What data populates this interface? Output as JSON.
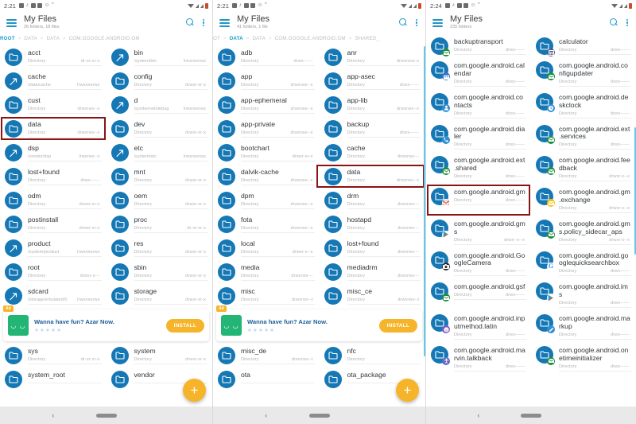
{
  "app": {
    "title": "My Files",
    "icons": {
      "menu": "hamburger-icon",
      "search": "search-icon",
      "overflow": "kebab-menu-icon",
      "fab": "add-fab-icon",
      "back": "back-nav-icon",
      "home": "home-pill-icon"
    }
  },
  "ad": {
    "tag": "Ad",
    "title": "Wanna have fun? Azar Now.",
    "stars": "★★★★★",
    "button": "INSTALL"
  },
  "colors": {
    "accent": "#1a9ad0",
    "folder": "#1578b5",
    "highlight": "#8a1313",
    "fab": "#f6b42a",
    "scrollbar": "#64c8e8"
  },
  "panels": [
    {
      "status": {
        "time": "2:21",
        "battery": "low"
      },
      "subtitle": "26 folders, 18 files",
      "breadcrumbs": [
        {
          "label": "ROOT",
          "active": true
        },
        {
          "label": "DATA",
          "active": false
        },
        {
          "label": "DATA",
          "active": false
        },
        {
          "label": "COM.GOOGLE.ANDROID.GM",
          "active": false
        }
      ],
      "items": [
        {
          "name": "acct",
          "type": "Directory",
          "perm": "dr-xr-xr-x",
          "kind": "folder"
        },
        {
          "name": "bin",
          "type": "/system/bin",
          "perm": "lrwxrwxrwx",
          "kind": "link"
        },
        {
          "name": "cache",
          "type": "/data/cache",
          "perm": "lrwxrwxrwx",
          "kind": "link"
        },
        {
          "name": "config",
          "type": "Directory",
          "perm": "drwxr-xr-x",
          "kind": "folder"
        },
        {
          "name": "cust",
          "type": "Directory",
          "perm": "drwxrwx--x",
          "kind": "folder"
        },
        {
          "name": "d",
          "type": "/sys/kernel/debug",
          "perm": "lrwxrwxrwx",
          "kind": "link"
        },
        {
          "name": "data",
          "type": "Directory",
          "perm": "drwxrwx--x",
          "kind": "folder",
          "highlight": true
        },
        {
          "name": "dev",
          "type": "Directory",
          "perm": "drwxr-xr-x",
          "kind": "folder"
        },
        {
          "name": "dsp",
          "type": "/vendor/dsp",
          "perm": "lrwxrwx--x",
          "kind": "link"
        },
        {
          "name": "etc",
          "type": "/system/etc",
          "perm": "lrwxrwxrwx",
          "kind": "link"
        },
        {
          "name": "lost+found",
          "type": "Directory",
          "perm": "drwx------",
          "kind": "folder"
        },
        {
          "name": "mnt",
          "type": "Directory",
          "perm": "drwxr-xr-x",
          "kind": "folder"
        },
        {
          "name": "odm",
          "type": "Directory",
          "perm": "drwxr-xr-x",
          "kind": "folder"
        },
        {
          "name": "oem",
          "type": "Directory",
          "perm": "drwxr-xr-x",
          "kind": "folder"
        },
        {
          "name": "postinstall",
          "type": "Directory",
          "perm": "drwxr-xr-x",
          "kind": "folder"
        },
        {
          "name": "proc",
          "type": "Directory",
          "perm": "dr-xr-xr-x",
          "kind": "folder"
        },
        {
          "name": "product",
          "type": "/system/product",
          "perm": "lrwxrwxrwx",
          "kind": "link"
        },
        {
          "name": "res",
          "type": "Directory",
          "perm": "drwxr-xr-x",
          "kind": "folder"
        },
        {
          "name": "root",
          "type": "Directory",
          "perm": "drwxr-x---",
          "kind": "folder"
        },
        {
          "name": "sbin",
          "type": "Directory",
          "perm": "drwxr-xr-x",
          "kind": "folder"
        },
        {
          "name": "sdcard",
          "type": "/storage/emulated/0",
          "perm": "lrwxrwxrwx",
          "kind": "link"
        },
        {
          "name": "storage",
          "type": "Directory",
          "perm": "drwxr-xr-x",
          "kind": "folder"
        }
      ],
      "items_after_ad": [
        {
          "name": "sys",
          "type": "Directory",
          "perm": "dr-xr-xr-x",
          "kind": "folder"
        },
        {
          "name": "system",
          "type": "Directory",
          "perm": "drwxr-xr-x",
          "kind": "folder"
        },
        {
          "name": "system_root",
          "type": "",
          "perm": "",
          "kind": "folder"
        },
        {
          "name": "vendor",
          "type": "",
          "perm": "",
          "kind": "folder"
        }
      ]
    },
    {
      "status": {
        "time": "2:21",
        "battery": "low"
      },
      "subtitle": "41 folders, 1 file",
      "breadcrumbs": [
        {
          "label": "OT",
          "active": false
        },
        {
          "label": "DATA",
          "active": true
        },
        {
          "label": "DATA",
          "active": false
        },
        {
          "label": "COM.GOOGLE.ANDROID.GM",
          "active": false
        },
        {
          "label": "SHARED_",
          "active": false
        }
      ],
      "items": [
        {
          "name": "adb",
          "type": "Directory",
          "perm": "drwx------",
          "kind": "folder"
        },
        {
          "name": "anr",
          "type": "Directory",
          "perm": "drwxrwxr-x",
          "kind": "folder"
        },
        {
          "name": "app",
          "type": "Directory",
          "perm": "drwxrwx--x",
          "kind": "folder"
        },
        {
          "name": "app-asec",
          "type": "Directory",
          "perm": "drwx------",
          "kind": "folder"
        },
        {
          "name": "app-ephemeral",
          "type": "Directory",
          "perm": "drwxrwx--x",
          "kind": "folder"
        },
        {
          "name": "app-lib",
          "type": "Directory",
          "perm": "drwxrwx--x",
          "kind": "folder"
        },
        {
          "name": "app-private",
          "type": "Directory",
          "perm": "drwxrwx--x",
          "kind": "folder"
        },
        {
          "name": "backup",
          "type": "Directory",
          "perm": "drwx------",
          "kind": "folder"
        },
        {
          "name": "bootchart",
          "type": "Directory",
          "perm": "drwxr-xr-x",
          "kind": "folder"
        },
        {
          "name": "cache",
          "type": "Directory",
          "perm": "drwxrwx---",
          "kind": "folder"
        },
        {
          "name": "dalvik-cache",
          "type": "Directory",
          "perm": "drwxrwx--x",
          "kind": "folder"
        },
        {
          "name": "data",
          "type": "Directory",
          "perm": "drwxrwx--x",
          "kind": "folder",
          "highlight": true
        },
        {
          "name": "dpm",
          "type": "Directory",
          "perm": "drwxrwx--x",
          "kind": "folder"
        },
        {
          "name": "drm",
          "type": "Directory",
          "perm": "drwxrwx---",
          "kind": "folder"
        },
        {
          "name": "fota",
          "type": "Directory",
          "perm": "drwxrwx--x",
          "kind": "folder"
        },
        {
          "name": "hostapd",
          "type": "Directory",
          "perm": "drwxrwx---",
          "kind": "folder"
        },
        {
          "name": "local",
          "type": "Directory",
          "perm": "drwxr-x--x",
          "kind": "folder"
        },
        {
          "name": "lost+found",
          "type": "Directory",
          "perm": "drwxrwx---",
          "kind": "folder"
        },
        {
          "name": "media",
          "type": "Directory",
          "perm": "drwxrwx---",
          "kind": "folder"
        },
        {
          "name": "mediadrm",
          "type": "Directory",
          "perm": "drwxrwx---",
          "kind": "folder"
        },
        {
          "name": "misc",
          "type": "Directory",
          "perm": "drwxrwx--t",
          "kind": "folder"
        },
        {
          "name": "misc_ce",
          "type": "Directory",
          "perm": "drwxrwx--t",
          "kind": "folder"
        }
      ],
      "items_after_ad": [
        {
          "name": "misc_de",
          "type": "Directory",
          "perm": "drwxrwx--t",
          "kind": "folder"
        },
        {
          "name": "nfc",
          "type": "Directory",
          "perm": "",
          "kind": "folder"
        },
        {
          "name": "ota",
          "type": "",
          "perm": "",
          "kind": "folder"
        },
        {
          "name": "ota_package",
          "type": "",
          "perm": "",
          "kind": "folder"
        }
      ]
    },
    {
      "status": {
        "time": "2:24",
        "battery": "low"
      },
      "subtitle": "235 folders",
      "breadcrumbs": [],
      "items": [
        {
          "name": "backuptransport",
          "type": "Directory",
          "perm": "drwx------",
          "kind": "app",
          "badge": "mail",
          "clipped": true
        },
        {
          "name": "calculator",
          "type": "Directory",
          "perm": "drwx------",
          "kind": "app",
          "badge": "calc",
          "clipped": true
        },
        {
          "name": "com.google.android.calendar",
          "type": "Directory",
          "perm": "drwx------",
          "kind": "app",
          "badge": "calendar"
        },
        {
          "name": "com.google.android.configupdater",
          "type": "Directory",
          "perm": "drwx------",
          "kind": "app",
          "badge": "mail"
        },
        {
          "name": "com.google.android.contacts",
          "type": "Directory",
          "perm": "drwx------",
          "kind": "app",
          "badge": "person"
        },
        {
          "name": "com.google.android.deskclock",
          "type": "Directory",
          "perm": "drwx------",
          "kind": "app",
          "badge": "clock"
        },
        {
          "name": "com.google.android.dialer",
          "type": "Directory",
          "perm": "drwx------",
          "kind": "app",
          "badge": "phone"
        },
        {
          "name": "com.google.android.ext.services",
          "type": "Directory",
          "perm": "drwx------",
          "kind": "app",
          "badge": "mail"
        },
        {
          "name": "com.google.android.ext.shared",
          "type": "Directory",
          "perm": "drwx------",
          "kind": "app",
          "badge": "mail"
        },
        {
          "name": "com.google.android.feedback",
          "type": "Directory",
          "perm": "drwxr-x--x",
          "kind": "app",
          "badge": "mail"
        },
        {
          "name": "com.google.android.gm",
          "type": "Directory",
          "perm": "drwx------",
          "kind": "app",
          "badge": "gmail",
          "highlight": true
        },
        {
          "name": "com.google.android.gm.exchange",
          "type": "Directory",
          "perm": "drwxr-x--x",
          "kind": "app",
          "badge": "envelope"
        },
        {
          "name": "com.google.android.gms",
          "type": "Directory",
          "perm": "drwx--x--x",
          "kind": "app",
          "badge": "play"
        },
        {
          "name": "com.google.android.gms.policy_sidecar_aps",
          "type": "Directory",
          "perm": "drwxr-x--x",
          "kind": "app",
          "badge": "mail"
        },
        {
          "name": "com.google.android.GoogleCamera",
          "type": "Directory",
          "perm": "drwx------",
          "kind": "app",
          "badge": "camera"
        },
        {
          "name": "com.google.android.googlequicksearchbox",
          "type": "Directory",
          "perm": "drwx------",
          "kind": "app",
          "badge": "google"
        },
        {
          "name": "com.google.android.gsf",
          "type": "Directory",
          "perm": "drwx------",
          "kind": "app",
          "badge": "mail"
        },
        {
          "name": "com.google.android.ims",
          "type": "Directory",
          "perm": "drwx------",
          "kind": "app",
          "badge": "play"
        },
        {
          "name": "com.google.android.inputmethod.latin",
          "type": "Directory",
          "perm": "drwx------",
          "kind": "app",
          "badge": "keyboard"
        },
        {
          "name": "com.google.android.markup",
          "type": "Directory",
          "perm": "drwx------",
          "kind": "app",
          "badge": "pen"
        },
        {
          "name": "com.google.android.marvin.talkback",
          "type": "Directory",
          "perm": "drwx------",
          "kind": "app",
          "badge": "talkback"
        },
        {
          "name": "com.google.android.onetimeinitializer",
          "type": "Directory",
          "perm": "drwx------",
          "kind": "app",
          "badge": "mail"
        }
      ],
      "items_after_ad": []
    }
  ]
}
